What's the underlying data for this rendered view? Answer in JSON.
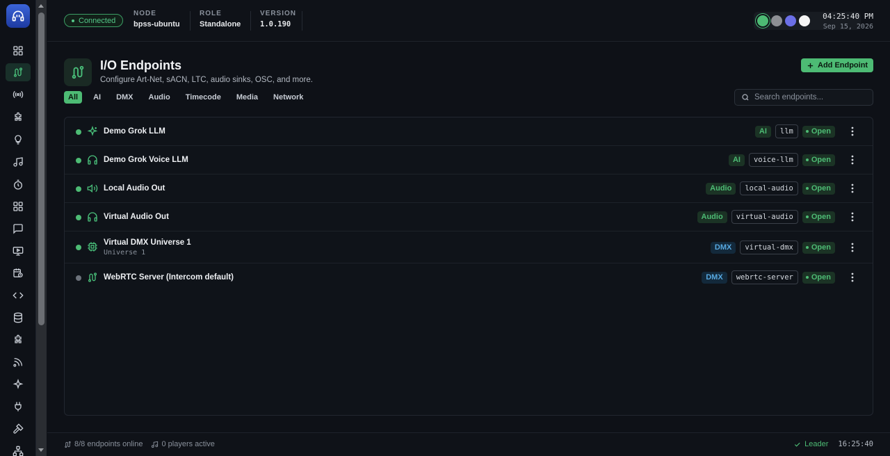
{
  "header": {
    "status": "Connected",
    "node_label": "NODE",
    "node_value": "bpss-ubuntu",
    "role_label": "ROLE",
    "role_value": "Standalone",
    "version_label": "VERSION",
    "version_value": "1.0.190",
    "time": "04:25:40 PM",
    "date": "Sep 15, 2026",
    "theme_swatches": [
      "#4dbb74",
      "#8d8f94",
      "#6b6fe6",
      "#f5f5f5"
    ]
  },
  "page": {
    "title": "I/O Endpoints",
    "subtitle": "Configure Art-Net, sACN, LTC, audio sinks, OSC, and more.",
    "add_button": "Add Endpoint",
    "search_placeholder": "Search endpoints..."
  },
  "filters": [
    "All",
    "AI",
    "DMX",
    "Audio",
    "Timecode",
    "Media",
    "Network"
  ],
  "endpoints": [
    {
      "name": "Demo Grok LLM",
      "category": "AI",
      "code": "llm",
      "state": "Open",
      "online": true,
      "icon": "sparkle-icon"
    },
    {
      "name": "Demo Grok Voice LLM",
      "category": "AI",
      "code": "voice-llm",
      "state": "Open",
      "online": true,
      "icon": "headphones-icon"
    },
    {
      "name": "Local Audio Out",
      "category": "Audio",
      "code": "local-audio",
      "state": "Open",
      "online": true,
      "icon": "speaker-icon"
    },
    {
      "name": "Virtual Audio Out",
      "category": "Audio",
      "code": "virtual-audio",
      "state": "Open",
      "online": true,
      "icon": "headphones-icon"
    },
    {
      "name": "Virtual DMX Universe 1",
      "subname": "Universe 1",
      "category": "DMX",
      "code": "virtual-dmx",
      "state": "Open",
      "online": true,
      "icon": "chip-icon"
    },
    {
      "name": "WebRTC Server (Intercom default)",
      "category": "DMX",
      "code": "webrtc-server",
      "state": "Open",
      "online": false,
      "icon": "route-icon"
    }
  ],
  "footer": {
    "endpoints_online": "8/8 endpoints online",
    "players_active": "0 players active",
    "leader": "Leader",
    "time": "16:25:40"
  },
  "colors": {
    "accent": "#4dbb74",
    "dmx": "#57a8e0",
    "background": "#0e1117"
  }
}
